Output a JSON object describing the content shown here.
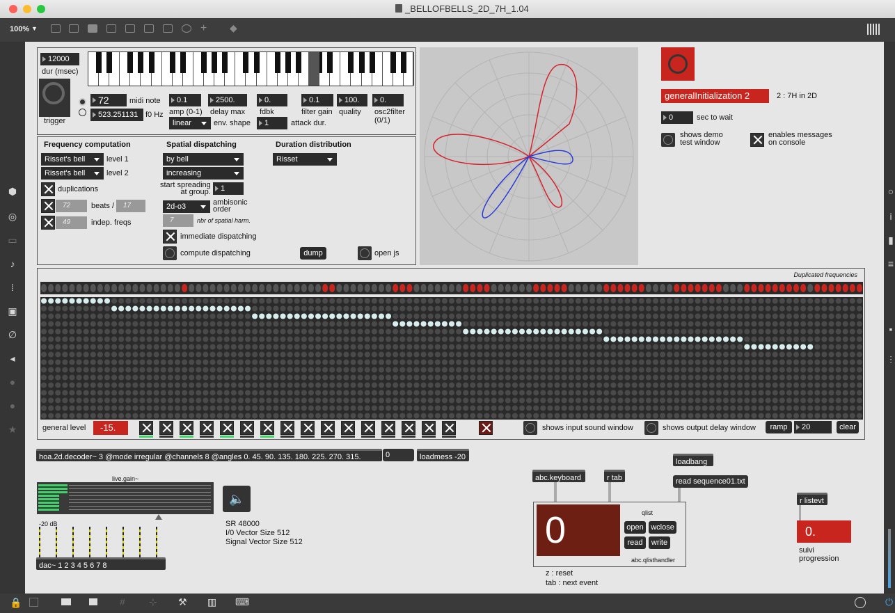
{
  "window": {
    "title": "_BELLOFBELLS_2D_7H_1.04",
    "zoom": "100%"
  },
  "keyboard": {
    "dur_value": "12000",
    "dur_label": "dur (msec)",
    "trigger_label": "trigger",
    "midi_note_value": "72",
    "midi_note_label": "midi note",
    "f0_value": "523.251131",
    "f0_label": "f0 Hz"
  },
  "params": {
    "amp_value": "0.1",
    "amp_label": "amp (0-1)",
    "delay_value": "2500.",
    "delay_label": "delay max",
    "fdbk_value": "0.",
    "fdbk_label": "fdbk",
    "filter_gain_value": "0.1",
    "filter_gain_label": "filter gain",
    "quality_value": "100.",
    "quality_label": "quality",
    "osc2filter_value": "0.",
    "osc2filter_label": "osc2filter\n(0/1)",
    "env_menu": "linear",
    "env_label": "env. shape",
    "attack_value": "1",
    "attack_label": "attack dur."
  },
  "freq": {
    "title": "Frequency computation",
    "level1_menu": "Risset's bell",
    "level1_label": "level 1",
    "level2_menu": "Risset's bell",
    "level2_label": "level 2",
    "duplications_label": "duplications",
    "beats_value": "72",
    "beats_label": "beats /",
    "beats_value2": "17",
    "indep_value": "49",
    "indep_label": "indep. freqs"
  },
  "spatial": {
    "title": "Spatial dispatching",
    "menu1": "by bell",
    "menu2": "increasing",
    "start_label": "start spreading\nat group.",
    "start_value": "1",
    "order_menu": "2d-o3",
    "order_label": "ambisonic\norder",
    "harm_value": "7",
    "harm_label": "nbr of spatial harm.",
    "immediate_label": "immediate dispatching",
    "compute_label": "compute dispatching",
    "dump_label": "dump",
    "open_js_label": "open js"
  },
  "duration": {
    "title": "Duration distribution",
    "menu": "Risset"
  },
  "init": {
    "message": "generalInitialization 2",
    "mode_label": "2 : 7H in 2D",
    "wait_value": "0",
    "wait_label": "sec to wait",
    "demo_label": "shows demo\ntest window",
    "console_label": "enables messages\non console"
  },
  "matrix": {
    "title": "Duplicated frequencies",
    "red_cols": [
      20,
      40,
      41,
      50,
      51,
      52,
      60,
      61,
      62,
      63,
      70,
      71,
      72,
      73,
      74,
      80,
      81,
      82,
      83,
      84,
      85,
      90,
      91,
      92,
      93,
      94,
      95,
      96,
      100,
      101,
      102,
      103,
      104,
      105,
      106,
      107,
      108,
      110,
      111,
      112,
      113,
      114,
      115,
      116,
      117
    ],
    "steps": [
      [
        0,
        10
      ],
      [
        10,
        30
      ],
      [
        30,
        50
      ],
      [
        50,
        60
      ],
      [
        60,
        80
      ],
      [
        80,
        100
      ],
      [
        100,
        110
      ]
    ]
  },
  "controls": {
    "general_level_label": "general level",
    "general_level_value": "-15.",
    "input_window_label": "shows input sound window",
    "output_window_label": "shows output delay window",
    "ramp_label": "ramp",
    "ramp_value": "20",
    "clear_label": "clear"
  },
  "audio": {
    "decoder": "hoa.2d.decoder~ 3 @mode irregular @channels 8 @angles 0. 45. 90. 135. 180. 225. 270. 315.",
    "zero_msg": "0",
    "loadmess": "loadmess -20",
    "gain_label": "live.gain~",
    "db_label": "-20 dB",
    "dac": "dac~ 1 2 3 4 5 6 7 8",
    "sr": "SR 48000",
    "io_vec": "I/0 Vector Size 512",
    "sig_vec": "Signal Vector Size 512"
  },
  "seq": {
    "abc_keyboard": "abc.keyboard",
    "r_tab": "r tab",
    "loadbang": "loadbang",
    "read_seq": "read sequence01.txt",
    "qlist_label": "qlist",
    "counter": "0",
    "open": "open",
    "wclose": "wclose",
    "read": "read",
    "write": "write",
    "handler": "abc.qlisthandler",
    "hint1": "z  : reset",
    "hint2": "tab : next event",
    "r_listevt": "r listevt",
    "suivi_value": "0.",
    "suivi_label": "suivi\nprogression"
  },
  "colors": {
    "accent_red": "#c8251f",
    "bg": "#e6e6e6",
    "dark_box": "#2b2b2b",
    "dot_off": "#3a3a3a",
    "dot_on": "#d8eeee"
  }
}
